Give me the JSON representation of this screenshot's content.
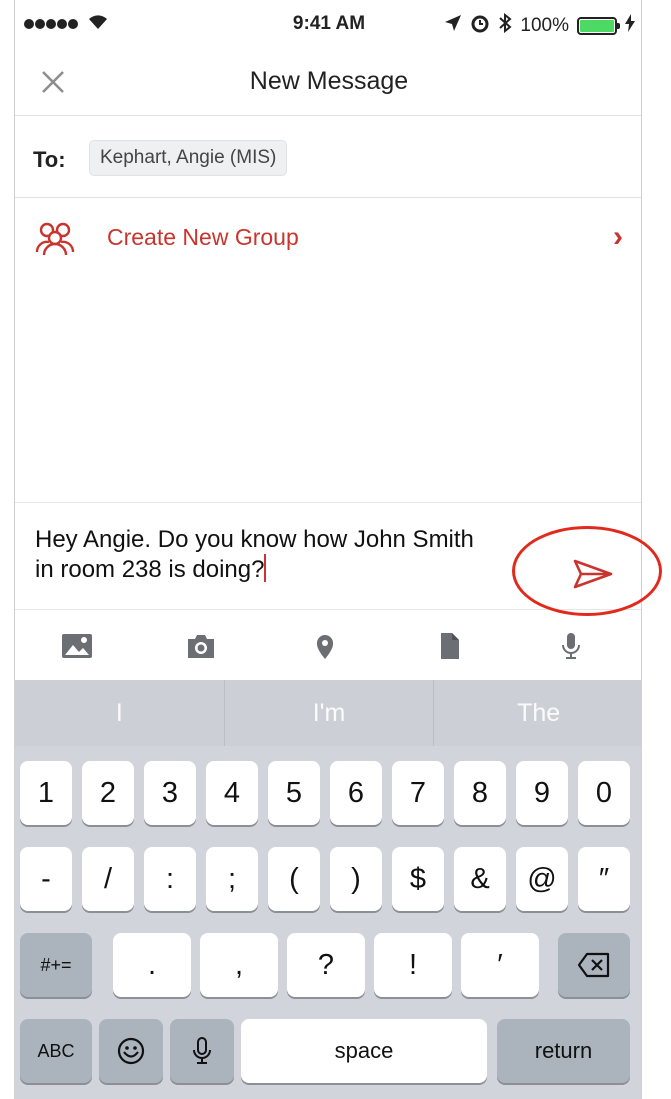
{
  "status_bar": {
    "time": "9:41 AM",
    "battery": "100%"
  },
  "nav": {
    "title": "New Message",
    "close_icon": "close-icon"
  },
  "to_row": {
    "label": "To:",
    "recipient": "Kephart, Angie (MIS)"
  },
  "group_row": {
    "label": "Create New Group",
    "icon": "group-icon",
    "chevron": "›"
  },
  "composer": {
    "text": "Hey Angie. Do you know how John Smith in room 238 is doing?"
  },
  "attachments": [
    "image-icon",
    "camera-icon",
    "location-pin-icon",
    "document-icon",
    "microphone-icon"
  ],
  "suggestions": [
    "I",
    "I'm",
    "The"
  ],
  "keyboard": {
    "row1": [
      "1",
      "2",
      "3",
      "4",
      "5",
      "6",
      "7",
      "8",
      "9",
      "0"
    ],
    "row2": [
      "-",
      "/",
      ":",
      ";",
      "(",
      ")",
      "$",
      "&",
      "@",
      "″"
    ],
    "row3": {
      "symbols": "#+=",
      "keys": [
        ".",
        ",",
        "?",
        "!",
        "′"
      ]
    },
    "row4": {
      "abc": "ABC",
      "space": "space",
      "return": "return"
    }
  },
  "colors": {
    "accent": "#c9352e",
    "annotation": "#e22a1c",
    "keyboard_bg": "#d1d5db"
  }
}
